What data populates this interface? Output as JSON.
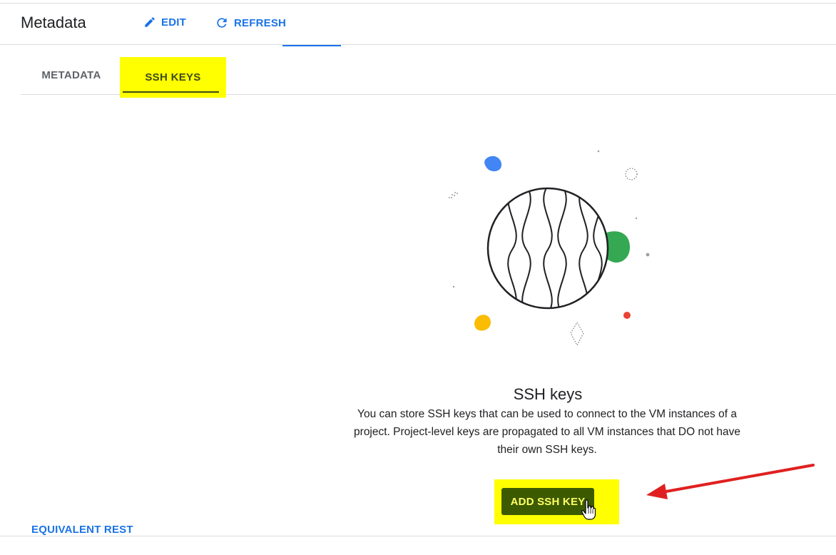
{
  "header": {
    "title": "Metadata",
    "edit_label": "EDIT",
    "refresh_label": "REFRESH"
  },
  "tabs": [
    {
      "label": "METADATA",
      "active": false
    },
    {
      "label": "SSH KEYS",
      "active": true
    }
  ],
  "empty_state": {
    "title": "SSH keys",
    "description": "You can store SSH keys that can be used to connect to the VM instances of a project. Project-level keys are propagated to all VM instances that DO not have their own SSH keys.",
    "button_label": "ADD SSH KEY"
  },
  "footer": {
    "link_label": "EQUIVALENT REST"
  },
  "icons": {
    "edit": "pencil-icon",
    "refresh": "refresh-icon",
    "cursor": "hand-pointer-icon"
  },
  "colors": {
    "accent": "#1a73e8",
    "highlight": "#ffff00",
    "button_bg": "#3c5a00",
    "arrow": "#e02020"
  }
}
